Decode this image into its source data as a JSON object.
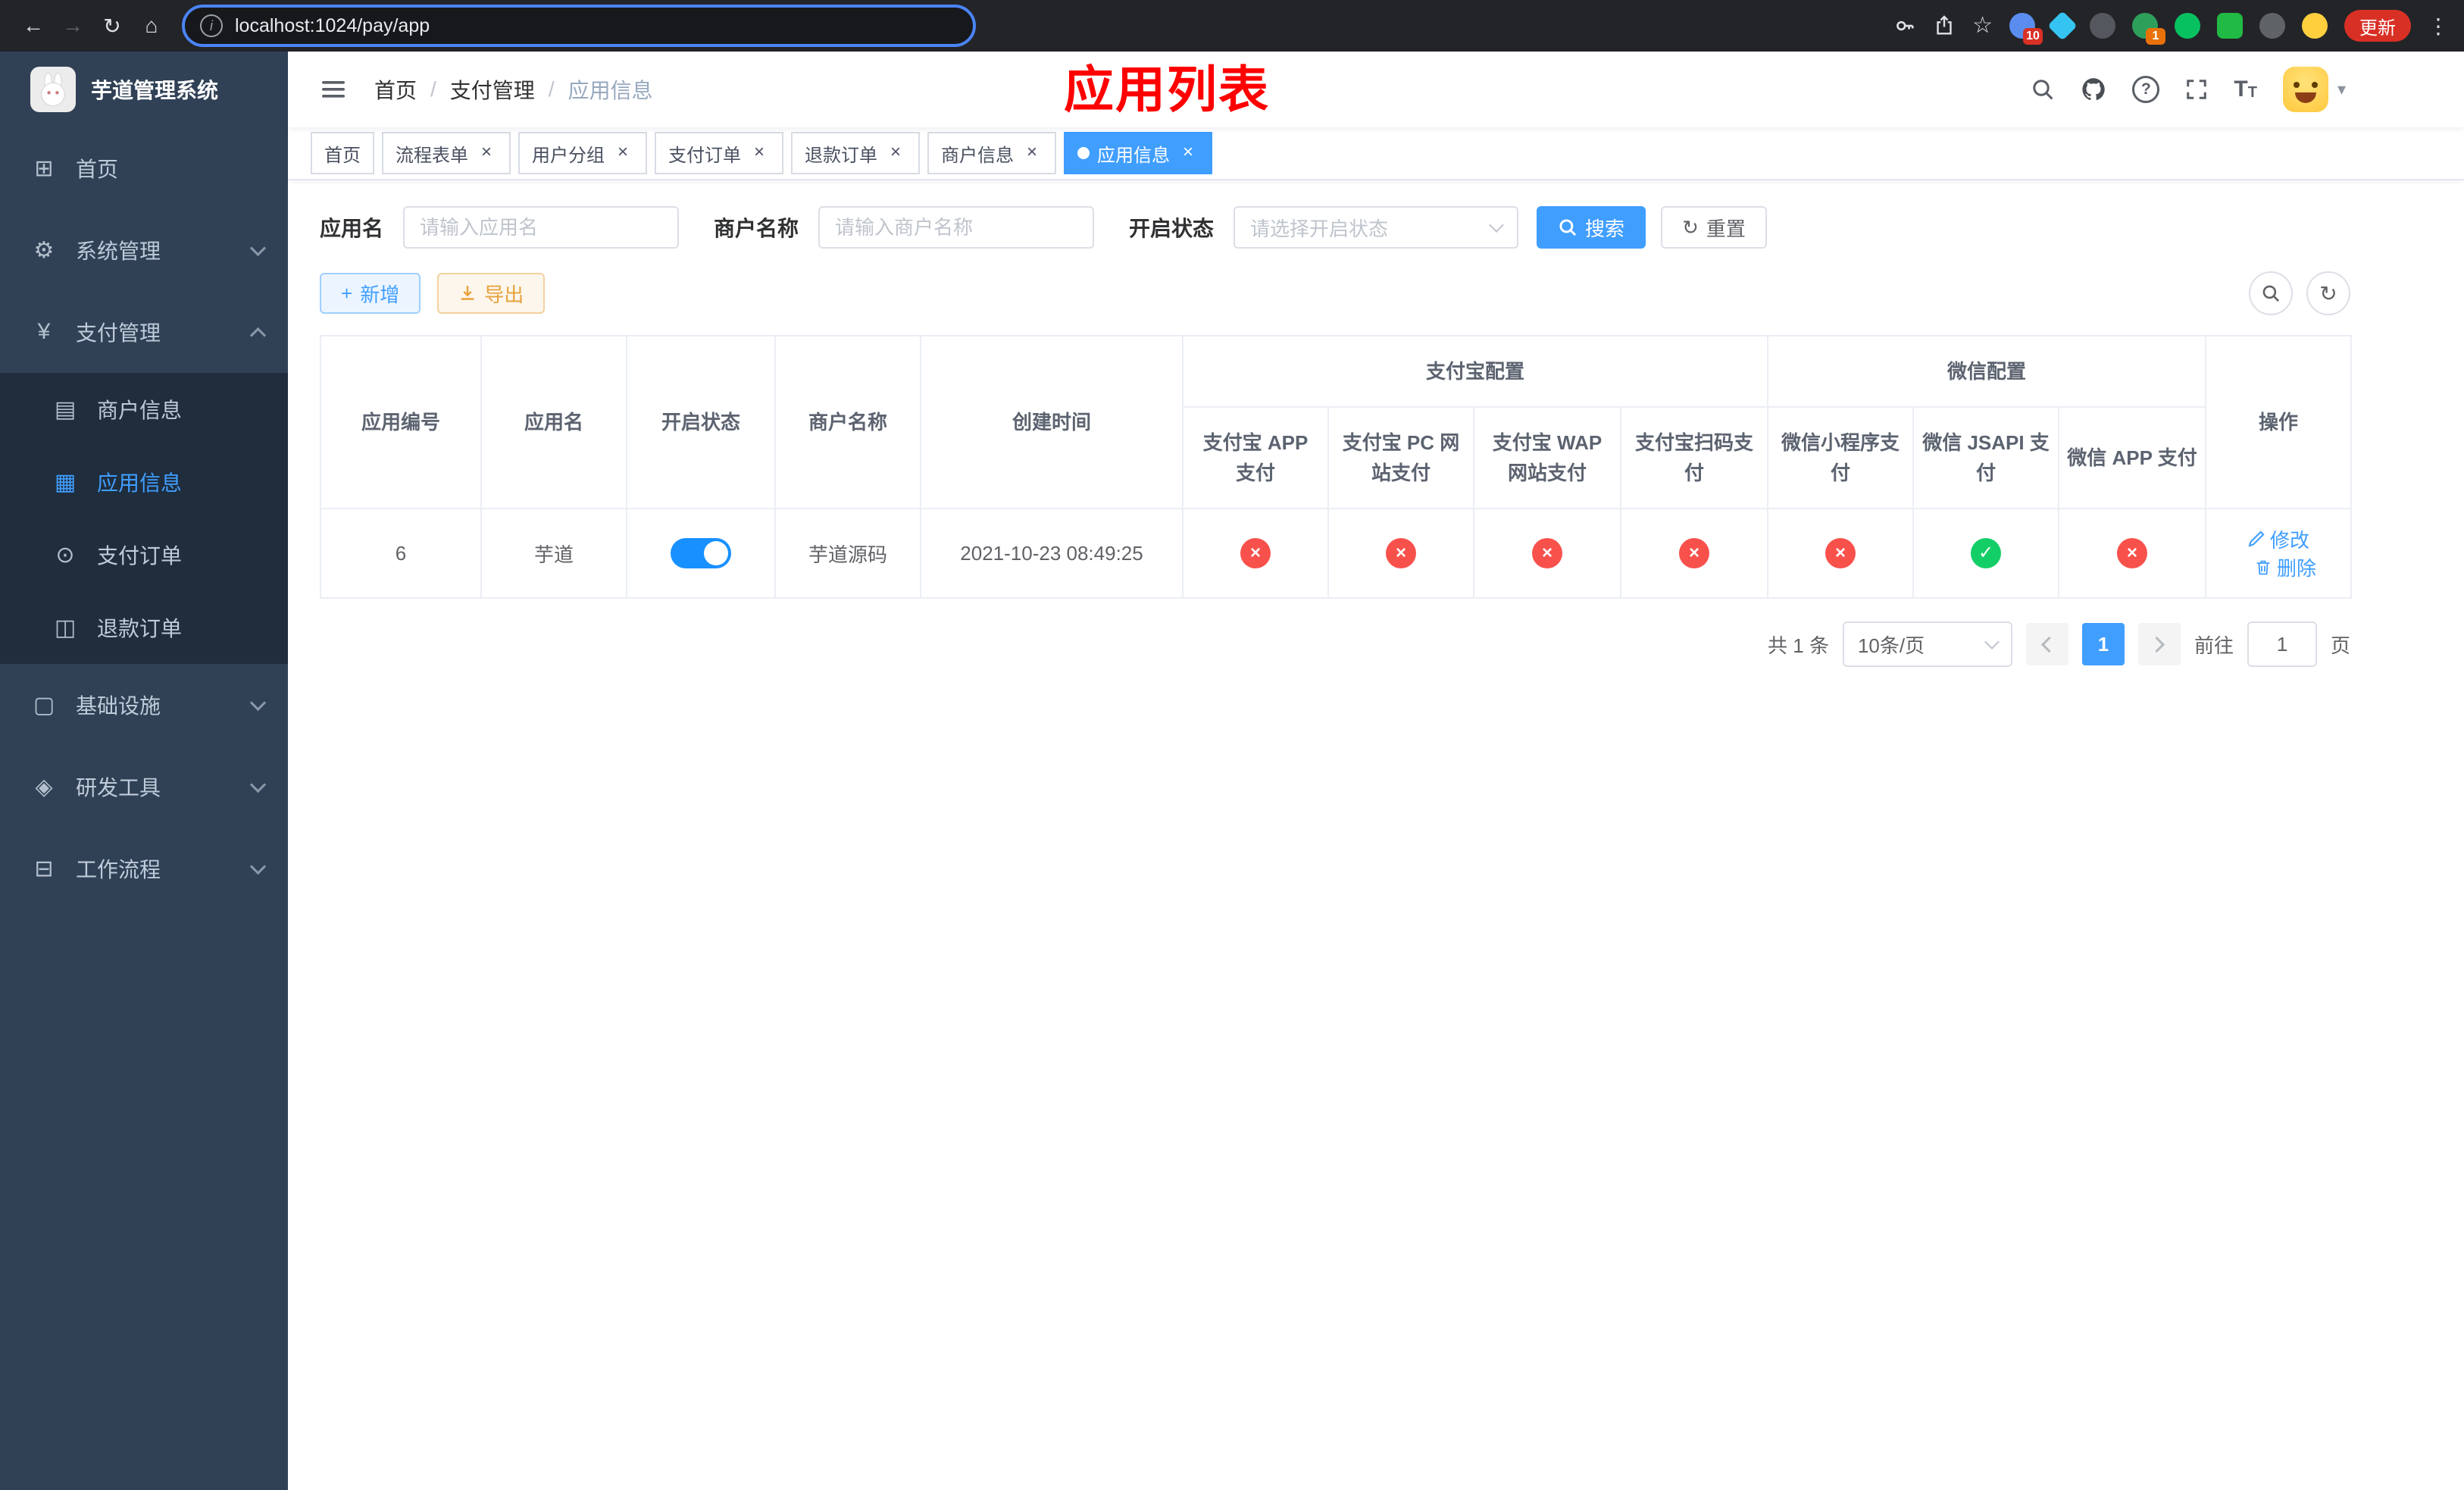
{
  "browser": {
    "url": "localhost:1024/pay/app",
    "update_label": "更新",
    "ext_badge_a": "10",
    "ext_badge_b": "1"
  },
  "icons": {
    "back": "←",
    "forward": "→",
    "reload": "↻",
    "home": "⌂",
    "info": "i",
    "star": "☆",
    "menu_dots": "⋮",
    "crumb_sep": "/",
    "close": "×",
    "plus": "+",
    "caret_down": "▾",
    "check": "✓",
    "cross": "×",
    "question": "?",
    "fontsize": "T",
    "yen": "¥",
    "dashboard": "⊞",
    "gear": "⚙",
    "card": "▤",
    "grid": "▦",
    "order": "⊙",
    "refund": "◫",
    "infra": "▢",
    "tools": "◈",
    "workflow": "⊟",
    "refresh": "↻",
    "download": "↓"
  },
  "sidebar": {
    "title": "芋道管理系统",
    "items": [
      {
        "label": "首页"
      },
      {
        "label": "系统管理"
      },
      {
        "label": "支付管理",
        "children": [
          {
            "label": "商户信息"
          },
          {
            "label": "应用信息"
          },
          {
            "label": "支付订单"
          },
          {
            "label": "退款订单"
          }
        ]
      },
      {
        "label": "基础设施"
      },
      {
        "label": "研发工具"
      },
      {
        "label": "工作流程"
      }
    ]
  },
  "navbar": {
    "breadcrumb": [
      "首页",
      "支付管理",
      "应用信息"
    ],
    "title_overlay": "应用列表"
  },
  "tabs": [
    {
      "label": "首页",
      "closable": false,
      "active": false
    },
    {
      "label": "流程表单",
      "closable": true,
      "active": false
    },
    {
      "label": "用户分组",
      "closable": true,
      "active": false
    },
    {
      "label": "支付订单",
      "closable": true,
      "active": false
    },
    {
      "label": "退款订单",
      "closable": true,
      "active": false
    },
    {
      "label": "商户信息",
      "closable": true,
      "active": false
    },
    {
      "label": "应用信息",
      "closable": true,
      "active": true
    }
  ],
  "filters": {
    "app_name_label": "应用名",
    "app_name_placeholder": "请输入应用名",
    "merchant_label": "商户名称",
    "merchant_placeholder": "请输入商户名称",
    "status_label": "开启状态",
    "status_placeholder": "请选择开启状态",
    "search_button": "搜索",
    "reset_button": "重置"
  },
  "toolbar": {
    "add_button": "新增",
    "export_button": "导出"
  },
  "table": {
    "col_id": "应用编号",
    "col_name": "应用名",
    "col_status": "开启状态",
    "col_merchant": "商户名称",
    "col_created": "创建时间",
    "group_alipay": "支付宝配置",
    "group_wechat": "微信配置",
    "col_alipay_app": "支付宝 APP 支付",
    "col_alipay_pc": "支付宝 PC 网站支付",
    "col_alipay_wap": "支付宝 WAP 网站支付",
    "col_alipay_qr": "支付宝扫码支付",
    "col_wx_mini": "微信小程序支付",
    "col_wx_jsapi": "微信 JSAPI 支付",
    "col_wx_app": "微信 APP 支付",
    "col_actions": "操作",
    "rows": [
      {
        "id": "6",
        "name": "芋道",
        "enabled": true,
        "merchant": "芋道源码",
        "created": "2021-10-23 08:49:25",
        "alipay_app": false,
        "alipay_pc": false,
        "alipay_wap": false,
        "alipay_qr": false,
        "wx_mini": false,
        "wx_jsapi": true,
        "wx_app": false,
        "edit": "修改",
        "delete": "删除"
      }
    ]
  },
  "pagination": {
    "total": "共 1 条",
    "size": "10条/页",
    "page": "1",
    "goto": "前往",
    "goto_value": "1",
    "unit": "页"
  },
  "colors": {
    "primary": "#409eff",
    "danger": "#f8514c",
    "success": "#13ce66",
    "sidebar_bg": "#304156",
    "submenu_bg": "#1f2d3d",
    "title_overlay": "#ff0000"
  }
}
